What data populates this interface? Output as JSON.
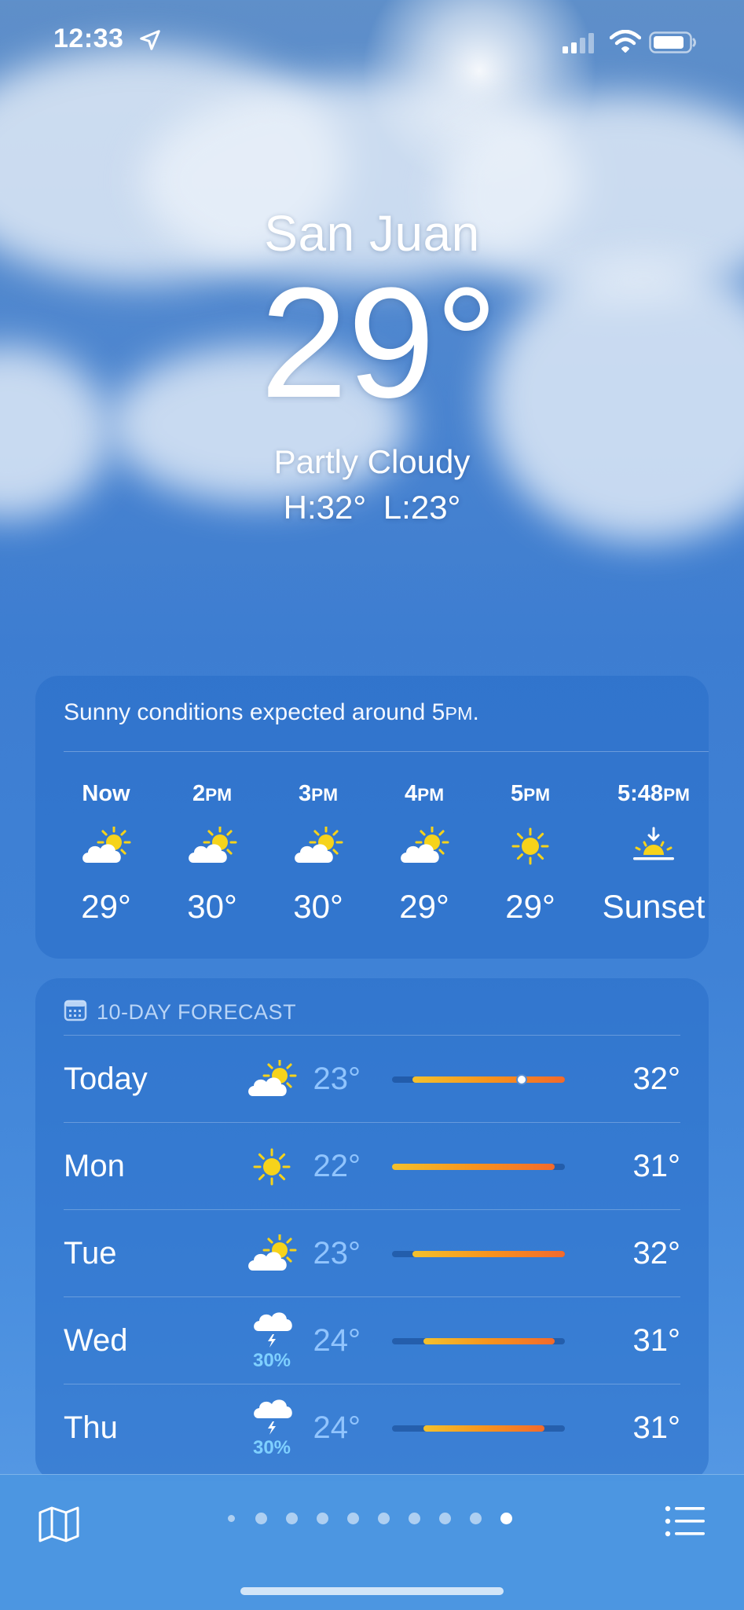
{
  "status_bar": {
    "time": "12:33"
  },
  "header": {
    "city": "San Juan",
    "temperature": "29°",
    "condition": "Partly Cloudy",
    "high_low": "H:32° L:23°"
  },
  "hourly": {
    "summary_prefix": "Sunny conditions expected around 5",
    "summary_suffix": "PM",
    "summary_end": ".",
    "hours": [
      {
        "label": "Now",
        "suffix": "",
        "icon": "partly-cloudy",
        "value": "29°"
      },
      {
        "label": "2",
        "suffix": "PM",
        "icon": "partly-cloudy",
        "value": "30°"
      },
      {
        "label": "3",
        "suffix": "PM",
        "icon": "partly-cloudy",
        "value": "30°"
      },
      {
        "label": "4",
        "suffix": "PM",
        "icon": "partly-cloudy",
        "value": "29°"
      },
      {
        "label": "5",
        "suffix": "PM",
        "icon": "sun",
        "value": "29°"
      },
      {
        "label": "5:48",
        "suffix": "PM",
        "icon": "sunset",
        "value": "Sunset"
      }
    ]
  },
  "forecast": {
    "title": "10-DAY FORECAST",
    "days": [
      {
        "day": "Today",
        "icon": "partly-cloudy",
        "precip": "",
        "low": "23°",
        "high": "32°",
        "bar_start": 0.12,
        "bar_end": 1.0,
        "current": 0.75
      },
      {
        "day": "Mon",
        "icon": "sun",
        "precip": "",
        "low": "22°",
        "high": "31°",
        "bar_start": 0.0,
        "bar_end": 0.94
      },
      {
        "day": "Tue",
        "icon": "partly-cloudy",
        "precip": "",
        "low": "23°",
        "high": "32°",
        "bar_start": 0.12,
        "bar_end": 1.0
      },
      {
        "day": "Wed",
        "icon": "thunderstorm",
        "precip": "30%",
        "low": "24°",
        "high": "31°",
        "bar_start": 0.18,
        "bar_end": 0.94
      },
      {
        "day": "Thu",
        "icon": "thunderstorm",
        "precip": "30%",
        "low": "24°",
        "high": "31°",
        "bar_start": 0.18,
        "bar_end": 0.88
      }
    ]
  },
  "pager": {
    "page_count": 10,
    "active_index": 9
  },
  "colors": {
    "accent_blue": "#3d7dd1",
    "temp_low": "#96c8ff",
    "sun_yellow": "#f6d31b",
    "bar_orange": "#f7941d"
  }
}
